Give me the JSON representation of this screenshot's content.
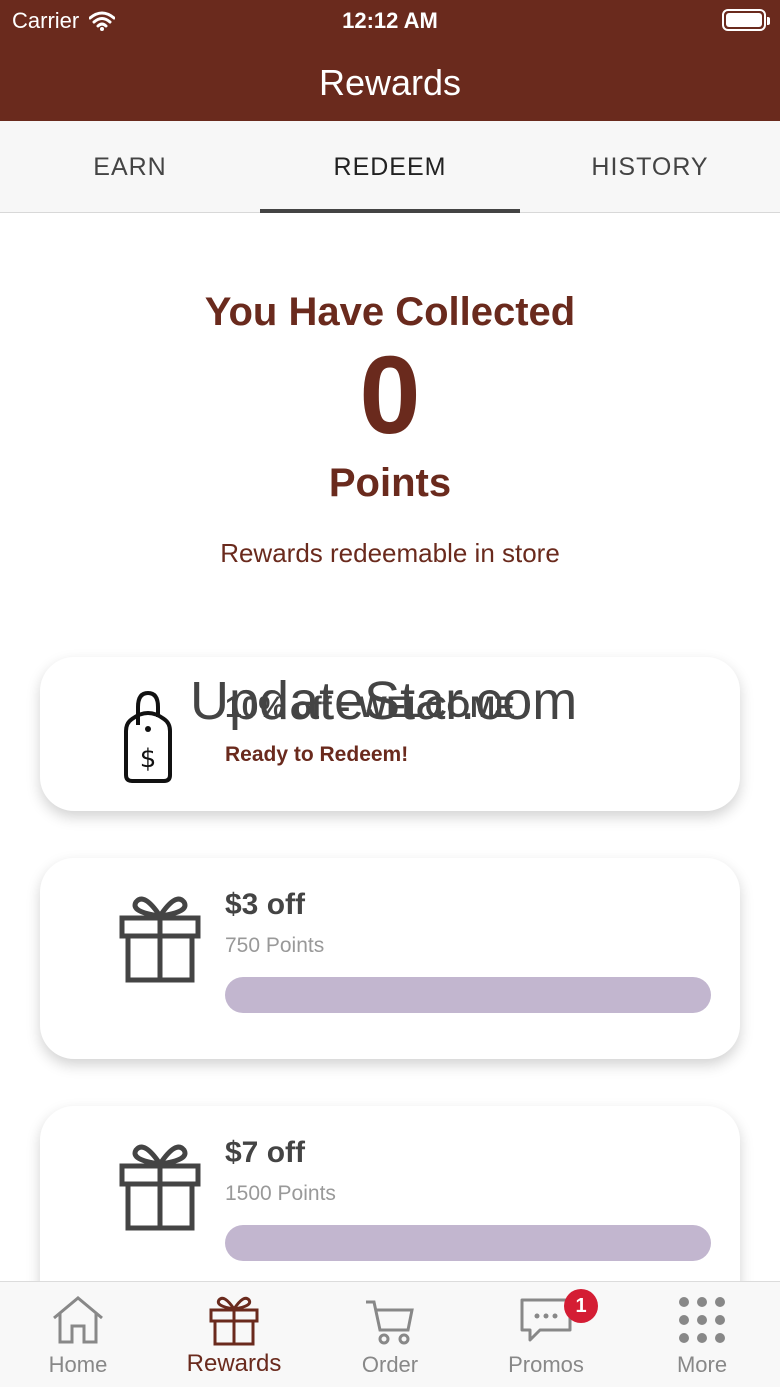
{
  "status_bar": {
    "carrier": "Carrier",
    "time": "12:12 AM"
  },
  "nav": {
    "title": "Rewards"
  },
  "tabs": [
    {
      "label": "EARN",
      "active": false
    },
    {
      "label": "REDEEM",
      "active": true
    },
    {
      "label": "HISTORY",
      "active": false
    }
  ],
  "summary": {
    "collected_label": "You Have Collected",
    "points_value": "0",
    "points_label": "Points",
    "note": "Rewards redeemable in store"
  },
  "rewards": [
    {
      "title": "10% off - WELCOME",
      "status": "Ready to Redeem!",
      "icon": "price-tag-icon"
    },
    {
      "title": "$3 off",
      "points": "750 Points",
      "progress": 0,
      "icon": "gift-icon"
    },
    {
      "title": "$7 off",
      "points": "1500 Points",
      "progress": 0,
      "icon": "gift-icon"
    }
  ],
  "watermark": "UpdateStar.com",
  "bottom_nav": [
    {
      "label": "Home",
      "icon": "home-icon"
    },
    {
      "label": "Rewards",
      "icon": "gift-icon",
      "active": true
    },
    {
      "label": "Order",
      "icon": "cart-icon"
    },
    {
      "label": "Promos",
      "icon": "chat-icon",
      "badge": "1"
    },
    {
      "label": "More",
      "icon": "grid-icon"
    }
  ],
  "colors": {
    "brand": "#6a2a1d",
    "progress": "#c2b6cf",
    "badge": "#d41d34"
  }
}
